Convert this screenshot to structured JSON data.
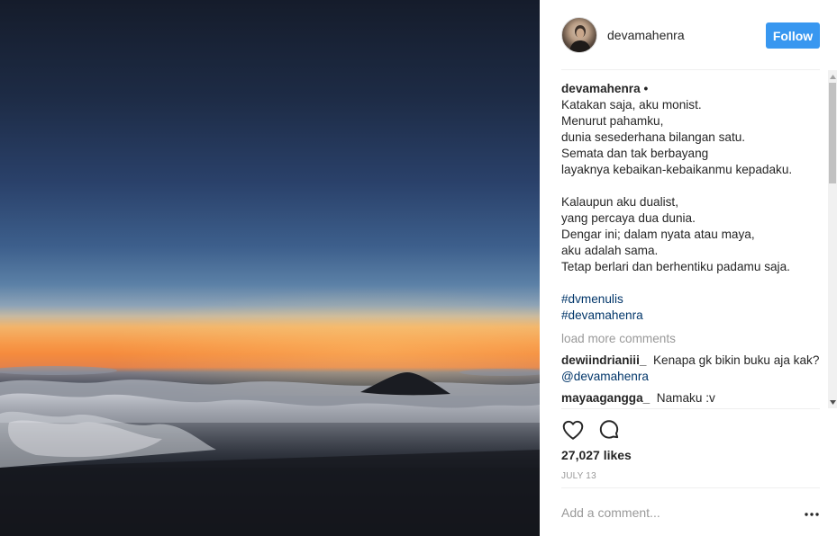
{
  "header": {
    "username": "devamahenra",
    "follow_label": "Follow"
  },
  "caption": {
    "username": "devamahenra",
    "bullet": "•",
    "lines": [
      "Katakan saja, aku monist.",
      "Menurut pahamku,",
      "dunia sesederhana bilangan satu.",
      "Semata dan tak berbayang",
      "layaknya kebaikan-kebaikanmu kepadaku.",
      "",
      "Kalaupun aku dualist,",
      "yang percaya dua dunia.",
      "Dengar ini; dalam nyata atau maya,",
      "aku adalah sama.",
      "Tetap berlari dan berhentiku padamu saja.",
      ""
    ],
    "hashtags": [
      "#dvmenulis",
      "#devamahenra"
    ]
  },
  "load_more_label": "load more comments",
  "comments": [
    {
      "user": "dewiindrianiii_",
      "text": "Kenapa gk bikin buku aja kak?",
      "mention": "@devamahenra"
    },
    {
      "user": "mayaagangga_",
      "text": "Namaku :v",
      "mention": ""
    }
  ],
  "actions": {
    "like_icon": "heart-icon",
    "comment_icon": "comment-icon"
  },
  "likes_label": "27,027 likes",
  "date_label": "JULY 13",
  "add_comment_placeholder": "Add a comment...",
  "more_icon": "more-options-icon",
  "colors": {
    "follow_button": "#3897f0",
    "link": "#003569",
    "muted": "#999999"
  }
}
